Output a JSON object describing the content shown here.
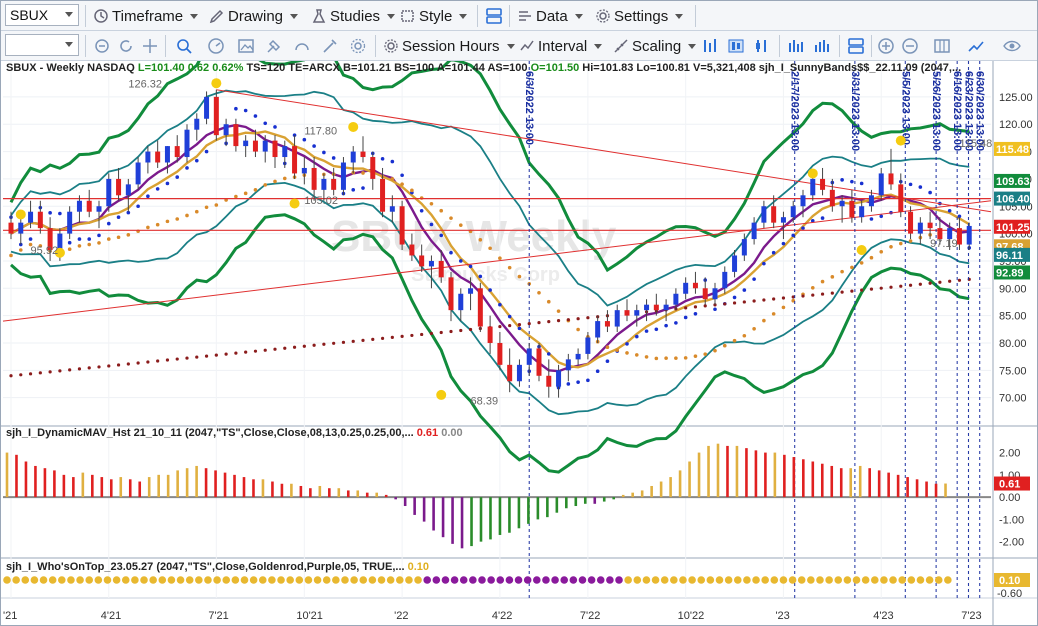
{
  "toolbar": {
    "symbol": "SBUX",
    "menus": {
      "timeframe": "Timeframe",
      "drawing": "Drawing",
      "studies": "Studies",
      "style": "Style",
      "data": "Data",
      "settings": "Settings",
      "session_hours": "Session Hours",
      "interval": "Interval",
      "scaling": "Scaling"
    },
    "icons": [
      "timeframe-icon",
      "drawing-icon",
      "studies-icon",
      "style-icon",
      "layout-icon",
      "data-icon",
      "settings-icon",
      "link-icon",
      "refresh-icon",
      "crosshair-icon",
      "zoom-icon",
      "gauge-icon",
      "image-icon",
      "paint-icon",
      "speed-icon",
      "tools-icon",
      "bar-icon",
      "candle-icon",
      "ohlc-icon",
      "plus-icon",
      "minus-icon",
      "grid-icon",
      "trend-icon",
      "eye-icon"
    ]
  },
  "header": {
    "price_line": "SBUX - Weekly  NASDAQ",
    "L": "L=101.40",
    "chg": "0.62",
    "chg_pct": "0.62%",
    "rest1": "TS=120  TE=ARCX  B=101.21  BS=100  A=101.44  AS=100",
    "O": "O=101.50",
    "rest2": "Hi=101.83  Lo=100.81  V=5,321,408",
    "study1": "sjh_I_SunnyBands$$_22.11.09 (2047,...",
    "panel2": "sjh_I_DynamicMAV_Hst 21_10_11 (2047,\"TS\",Close,Close,08,13,0.25,0.25,00,...",
    "panel2_val": "0.61",
    "panel2_val2": "0.00",
    "panel3": "sjh_I_Who'sOnTop_23.05.27 (2047,\"TS\",Close,Goldenrod,Purple,05,  TRUE,...",
    "panel3_val": "0.10"
  },
  "watermark": {
    "line1": "SBUX Weekly",
    "line2": "Starbucks Corp"
  },
  "chart_data": {
    "type": "candlestick",
    "price_axis_ticks": [
      "125.00",
      "120.00",
      "115.00",
      "110.00",
      "105.00",
      "100.00",
      "95.00",
      "90.00",
      "85.00",
      "80.00",
      "75.00",
      "70.00"
    ],
    "ylim": [
      65,
      129
    ],
    "x_tick_labels": [
      "'21",
      "4'21",
      "7'21",
      "10'21",
      "'22",
      "4'22",
      "7'22",
      "10'22",
      "'23",
      "4'23",
      "7'23"
    ],
    "price_labels": [
      {
        "text": "126.32",
        "x": 16,
        "y": 126.32
      },
      {
        "text": "117.80",
        "x": 40,
        "y": 117.8
      },
      {
        "text": "105.02",
        "x": 40,
        "y": 105.02
      },
      {
        "text": "95.92",
        "x": 2,
        "y": 95.92
      },
      {
        "text": "68.39",
        "x": 63,
        "y": 68.39
      },
      {
        "text": "115.48",
        "x": 129,
        "y": 115.48
      },
      {
        "text": "97.19",
        "x": 125,
        "y": 97.19
      }
    ],
    "axis_badges": [
      {
        "text": "115.48",
        "y": 115.48,
        "bg": "#f0c020",
        "fg": "#ffffff"
      },
      {
        "text": "109.63",
        "y": 109.63,
        "bg": "#118c3c",
        "fg": "#ffffff"
      },
      {
        "text": "106.40",
        "y": 106.4,
        "bg": "#1a7f86",
        "fg": "#ffffff"
      },
      {
        "text": "101.25",
        "y": 101.25,
        "bg": "#e02020",
        "fg": "#ffffff"
      },
      {
        "text": "97.68",
        "y": 97.68,
        "bg": "#d9a233",
        "fg": "#ffffff"
      },
      {
        "text": "96.11",
        "y": 96.11,
        "bg": "#1a7f86",
        "fg": "#ffffff"
      },
      {
        "text": "92.89",
        "y": 92.89,
        "bg": "#118c3c",
        "fg": "#ffffff"
      }
    ],
    "date_markers": [
      "6/3/2022 13:00",
      "2/17/2023 13:00",
      "3/31/2023 13:00",
      "5/5/2023 13:00",
      "5/26/2023 13:00",
      "6/16/2023 13:00",
      "6/23/2023 13:00",
      "6/30/2023 13:00"
    ],
    "horizontal_levels": [
      106.4,
      100.6
    ],
    "ohlc": [
      [
        102,
        104,
        99,
        100
      ],
      [
        100,
        103,
        98,
        102
      ],
      [
        102,
        106,
        101,
        104
      ],
      [
        104,
        106,
        100,
        101
      ],
      [
        101,
        103,
        95,
        97
      ],
      [
        97,
        101,
        95,
        100
      ],
      [
        100,
        105,
        99,
        104
      ],
      [
        104,
        107,
        102,
        106
      ],
      [
        106,
        108,
        103,
        104
      ],
      [
        104,
        106,
        101,
        105
      ],
      [
        105,
        111,
        104,
        110
      ],
      [
        110,
        112,
        106,
        107
      ],
      [
        107,
        110,
        104,
        109
      ],
      [
        109,
        114,
        108,
        113
      ],
      [
        113,
        116,
        111,
        115
      ],
      [
        115,
        117,
        112,
        113
      ],
      [
        113,
        116,
        111,
        116
      ],
      [
        116,
        118,
        113,
        114
      ],
      [
        114,
        120,
        113,
        119
      ],
      [
        119,
        122,
        117,
        121
      ],
      [
        121,
        126,
        120,
        125
      ],
      [
        125,
        126.3,
        117,
        118
      ],
      [
        118,
        121,
        116,
        120
      ],
      [
        120,
        121,
        115,
        116
      ],
      [
        116,
        118,
        114,
        117
      ],
      [
        117,
        119,
        114,
        115
      ],
      [
        115,
        118,
        113,
        117
      ],
      [
        117,
        118,
        112,
        114
      ],
      [
        114,
        117,
        112,
        116
      ],
      [
        116,
        118,
        110,
        111
      ],
      [
        111,
        114,
        109,
        112
      ],
      [
        112,
        114,
        106,
        108
      ],
      [
        108,
        111,
        106,
        110
      ],
      [
        110,
        112,
        107,
        108
      ],
      [
        108,
        114,
        107,
        113
      ],
      [
        113,
        116,
        111,
        115
      ],
      [
        115,
        117.8,
        113,
        114
      ],
      [
        114,
        115,
        108,
        110
      ],
      [
        110,
        112,
        103,
        104
      ],
      [
        104,
        107,
        102,
        105
      ],
      [
        105,
        106,
        97,
        98
      ],
      [
        98,
        100,
        95,
        96
      ],
      [
        96,
        98,
        93,
        94
      ],
      [
        94,
        96,
        90,
        95
      ],
      [
        95,
        97,
        91,
        92
      ],
      [
        92,
        93,
        84,
        86
      ],
      [
        86,
        90,
        84,
        89
      ],
      [
        89,
        92,
        86,
        90
      ],
      [
        90,
        91,
        82,
        83
      ],
      [
        83,
        85,
        78,
        80
      ],
      [
        80,
        82,
        75,
        76
      ],
      [
        76,
        79,
        71,
        73
      ],
      [
        73,
        77,
        72,
        76
      ],
      [
        76,
        80,
        74,
        79
      ],
      [
        79,
        80,
        73,
        74
      ],
      [
        74,
        77,
        70,
        72
      ],
      [
        72,
        76,
        70,
        75
      ],
      [
        75,
        78,
        73,
        77
      ],
      [
        77,
        79,
        76,
        78
      ],
      [
        78,
        82,
        77,
        81
      ],
      [
        81,
        85,
        80,
        84
      ],
      [
        84,
        86,
        82,
        83
      ],
      [
        83,
        87,
        82,
        86
      ],
      [
        86,
        88,
        84,
        85
      ],
      [
        85,
        87,
        83,
        86
      ],
      [
        86,
        88,
        84,
        87
      ],
      [
        87,
        89,
        85,
        86
      ],
      [
        86,
        88,
        84,
        87
      ],
      [
        87,
        90,
        86,
        89
      ],
      [
        89,
        92,
        88,
        91
      ],
      [
        91,
        93,
        89,
        90
      ],
      [
        90,
        92,
        87,
        88
      ],
      [
        88,
        91,
        87,
        90
      ],
      [
        90,
        94,
        89,
        93
      ],
      [
        93,
        97,
        92,
        96
      ],
      [
        96,
        100,
        95,
        99
      ],
      [
        99,
        103,
        98,
        102
      ],
      [
        102,
        106,
        101,
        105
      ],
      [
        105,
        107,
        101,
        102
      ],
      [
        102,
        104,
        99,
        103
      ],
      [
        103,
        106,
        102,
        105
      ],
      [
        105,
        108,
        103,
        107
      ],
      [
        107,
        111,
        106,
        110
      ],
      [
        110,
        112,
        107,
        108
      ],
      [
        108,
        110,
        104,
        105
      ],
      [
        105,
        107,
        102,
        106
      ],
      [
        106,
        108,
        102,
        103
      ],
      [
        103,
        106,
        102,
        105
      ],
      [
        105,
        108,
        104,
        107
      ],
      [
        107,
        112,
        106,
        111
      ],
      [
        111,
        115.5,
        108,
        109
      ],
      [
        109,
        111,
        103,
        104
      ],
      [
        104,
        105,
        99,
        100
      ],
      [
        100,
        103,
        98,
        102
      ],
      [
        102,
        104,
        99,
        101
      ],
      [
        101,
        103,
        98,
        99
      ],
      [
        99,
        102,
        97,
        101
      ],
      [
        101,
        103,
        97,
        98
      ],
      [
        98,
        102,
        97,
        101.4
      ]
    ],
    "bands": {
      "outer_upper_color": "#118c3c",
      "outer_lower_color": "#118c3c",
      "inner_color": "#1a7f86",
      "ma_purple": "#7b1a8c",
      "ma_gold": "#d9a233",
      "dots_blue": "#1830d0",
      "dots_orange": "#d98a2a",
      "dots_maroon": "#8b1c1c"
    },
    "panel2": {
      "axis_ticks": [
        "2.00",
        "1.00",
        "0.00",
        "-1.00",
        "-2.00"
      ],
      "ylim": [
        -2.6,
        2.7
      ],
      "last_value": "0.61",
      "values": [
        2.0,
        1.9,
        1.6,
        1.4,
        1.3,
        1.2,
        1.0,
        0.9,
        1.1,
        1.0,
        0.9,
        0.8,
        0.9,
        0.8,
        0.7,
        0.9,
        1.0,
        1.0,
        1.2,
        1.3,
        1.4,
        1.3,
        1.2,
        1.1,
        1.0,
        0.9,
        0.8,
        0.8,
        0.7,
        0.6,
        0.6,
        0.5,
        0.4,
        0.5,
        0.4,
        0.4,
        0.3,
        0.3,
        0.2,
        0.2,
        0.1,
        -0.1,
        -0.4,
        -0.8,
        -1.1,
        -1.5,
        -1.8,
        -2.1,
        -2.3,
        -2.2,
        -2.0,
        -1.9,
        -1.7,
        -1.6,
        -1.4,
        -1.2,
        -1.0,
        -0.9,
        -0.7,
        -0.5,
        -0.4,
        -0.3,
        -0.3,
        -0.2,
        -0.1,
        0.1,
        0.2,
        0.3,
        0.5,
        0.7,
        0.9,
        1.2,
        1.6,
        2.0,
        2.3,
        2.4,
        2.3,
        2.3,
        2.2,
        2.1,
        2.0,
        2.0,
        1.9,
        1.8,
        1.7,
        1.6,
        1.5,
        1.4,
        1.3,
        1.3,
        1.4,
        1.3,
        1.2,
        1.1,
        1.0,
        0.9,
        0.8,
        0.7,
        0.6,
        0.61
      ],
      "colors": {
        "red": "#e02020",
        "gold": "#e0b040",
        "purple": "#7b1a8c",
        "green": "#2a8c2a"
      }
    },
    "panel3": {
      "axis_ticks": [
        "0.10",
        "-0.60"
      ],
      "last_value": "0.10",
      "colors": {
        "gold": "#e8b830",
        "purple": "#8a1a9c"
      }
    }
  }
}
